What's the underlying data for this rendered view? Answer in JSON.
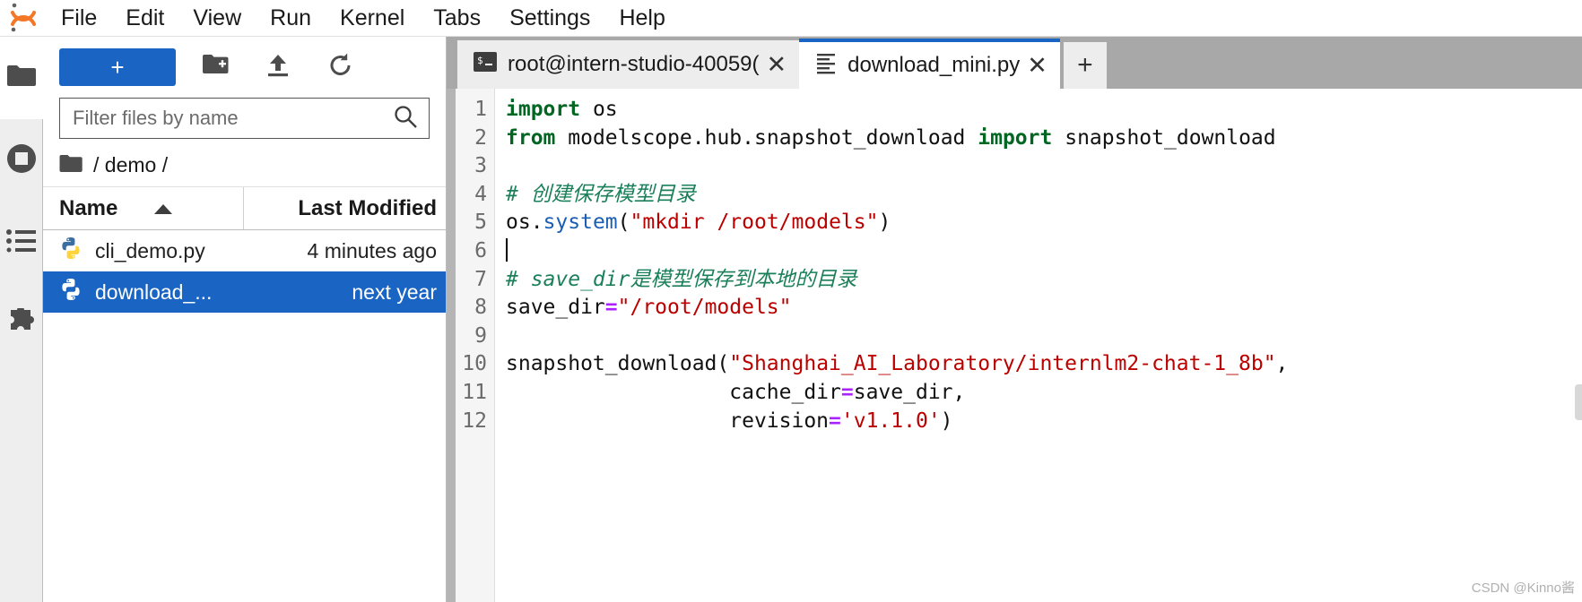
{
  "app": {
    "title": "JupyterLab",
    "logo_icon": "jupyter-logo-icon"
  },
  "menubar": {
    "items": [
      {
        "label": "File",
        "name": "menu-file"
      },
      {
        "label": "Edit",
        "name": "menu-edit"
      },
      {
        "label": "View",
        "name": "menu-view"
      },
      {
        "label": "Run",
        "name": "menu-run"
      },
      {
        "label": "Kernel",
        "name": "menu-kernel"
      },
      {
        "label": "Tabs",
        "name": "menu-tabs"
      },
      {
        "label": "Settings",
        "name": "menu-settings"
      },
      {
        "label": "Help",
        "name": "menu-help"
      }
    ]
  },
  "activitybar": {
    "items": [
      {
        "icon": "folder-icon",
        "name": "sidebar-item-file-browser",
        "active": true
      },
      {
        "icon": "running-terminals-icon",
        "name": "sidebar-item-running",
        "active": false
      },
      {
        "icon": "commands-list-icon",
        "name": "sidebar-item-commands",
        "active": false
      },
      {
        "icon": "puzzle-piece-icon",
        "name": "sidebar-item-extensions",
        "active": false
      }
    ]
  },
  "filebrowser": {
    "toolbar": {
      "new_launcher_label": "+",
      "new_folder_icon": "new-folder-icon",
      "upload_icon": "upload-icon",
      "refresh_icon": "refresh-icon"
    },
    "filter": {
      "placeholder": "Filter files by name",
      "value": "",
      "search_icon": "search-icon"
    },
    "breadcrumb": {
      "folder_icon": "folder-icon",
      "path": "/ demo /"
    },
    "columns": {
      "name": "Name",
      "last_modified": "Last Modified",
      "sort_direction": "ascending"
    },
    "files": [
      {
        "icon": "python-file-icon",
        "name": "cli_demo.py",
        "modified": "4 minutes ago",
        "selected": false
      },
      {
        "icon": "python-file-icon",
        "name": "download_...",
        "modified": "next year",
        "selected": true
      }
    ]
  },
  "dock": {
    "tabs": [
      {
        "label": "root@intern-studio-40059(",
        "icon": "terminal-icon",
        "active": false,
        "closable": true,
        "close_label": "✕"
      },
      {
        "label": "download_mini.py",
        "icon": "text-file-icon",
        "active": true,
        "closable": true,
        "close_label": "✕"
      }
    ],
    "add_tab_label": "+"
  },
  "editor": {
    "filename": "download_mini.py",
    "line_numbers": [
      1,
      2,
      3,
      4,
      5,
      6,
      7,
      8,
      9,
      10,
      11,
      12
    ],
    "cursor_line": 6,
    "lines": [
      {
        "n": 1,
        "text": "import os"
      },
      {
        "n": 2,
        "text": "from modelscope.hub.snapshot_download import snapshot_download"
      },
      {
        "n": 3,
        "text": ""
      },
      {
        "n": 4,
        "text": "# 创建保存模型目录"
      },
      {
        "n": 5,
        "text": "os.system(\"mkdir /root/models\")"
      },
      {
        "n": 6,
        "text": ""
      },
      {
        "n": 7,
        "text": "# save_dir是模型保存到本地的目录"
      },
      {
        "n": 8,
        "text": "save_dir=\"/root/models\""
      },
      {
        "n": 9,
        "text": ""
      },
      {
        "n": 10,
        "text": "snapshot_download(\"Shanghai_AI_Laboratory/internlm2-chat-1_8b\","
      },
      {
        "n": 11,
        "text": "                  cache_dir=save_dir,"
      },
      {
        "n": 12,
        "text": "                  revision='v1.1.0')"
      }
    ]
  },
  "watermark": "CSDN @Kinno酱",
  "colors": {
    "accent_blue": "#1a65c4",
    "tabbar_grey": "#a8a8a8",
    "keyword_green": "#006621",
    "comment_green": "#1a7f5a",
    "string_red": "#bb0000",
    "function_blue": "#1a5fb4",
    "operator_purple": "#aa22ff",
    "selected_row_blue": "#1a65c4"
  }
}
